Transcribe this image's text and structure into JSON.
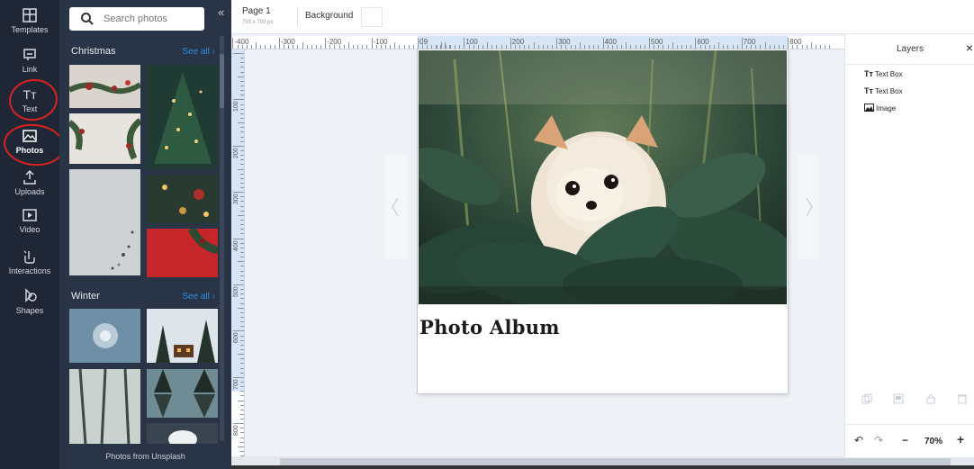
{
  "rail": {
    "items": [
      {
        "label": "Templates"
      },
      {
        "label": "Link"
      },
      {
        "label": "Text"
      },
      {
        "label": "Photos"
      },
      {
        "label": "Uploads"
      },
      {
        "label": "Video"
      },
      {
        "label": "Interactions"
      },
      {
        "label": "Shapes"
      }
    ]
  },
  "panel": {
    "search_placeholder": "Search photos",
    "collapse": "«",
    "sections": [
      {
        "title": "Christmas",
        "see_all": "See all ›"
      },
      {
        "title": "Winter",
        "see_all": "See all ›"
      }
    ],
    "footer": "Photos from Unsplash"
  },
  "topbar": {
    "page_label": "Page 1",
    "page_size": "793 x 793 px",
    "background_label": "Background"
  },
  "ruler": {
    "h_ticks": [
      "-400",
      "-300",
      "-200",
      "-100",
      "0",
      "100",
      "200",
      "300",
      "400",
      "500",
      "600",
      "700",
      "800",
      "9"
    ],
    "v_ticks": [
      "100",
      "200",
      "300",
      "400",
      "500",
      "600",
      "700",
      "800",
      "900"
    ]
  },
  "canvas": {
    "title_text": "Photo Album"
  },
  "layers": {
    "title": "Layers",
    "close": "×",
    "items": [
      {
        "icon": "text-box-icon",
        "prefix": "Tт",
        "label": "Text Box"
      },
      {
        "icon": "text-box-icon",
        "prefix": "Tт",
        "label": "Text Box"
      },
      {
        "icon": "image-icon",
        "label": "Image"
      }
    ],
    "zoom": "70%"
  },
  "colors": {
    "rail_bg": "#1f2737",
    "panel_bg": "#2a3447",
    "link_blue": "#2f8ce6",
    "annotation_red": "#d9221f"
  }
}
